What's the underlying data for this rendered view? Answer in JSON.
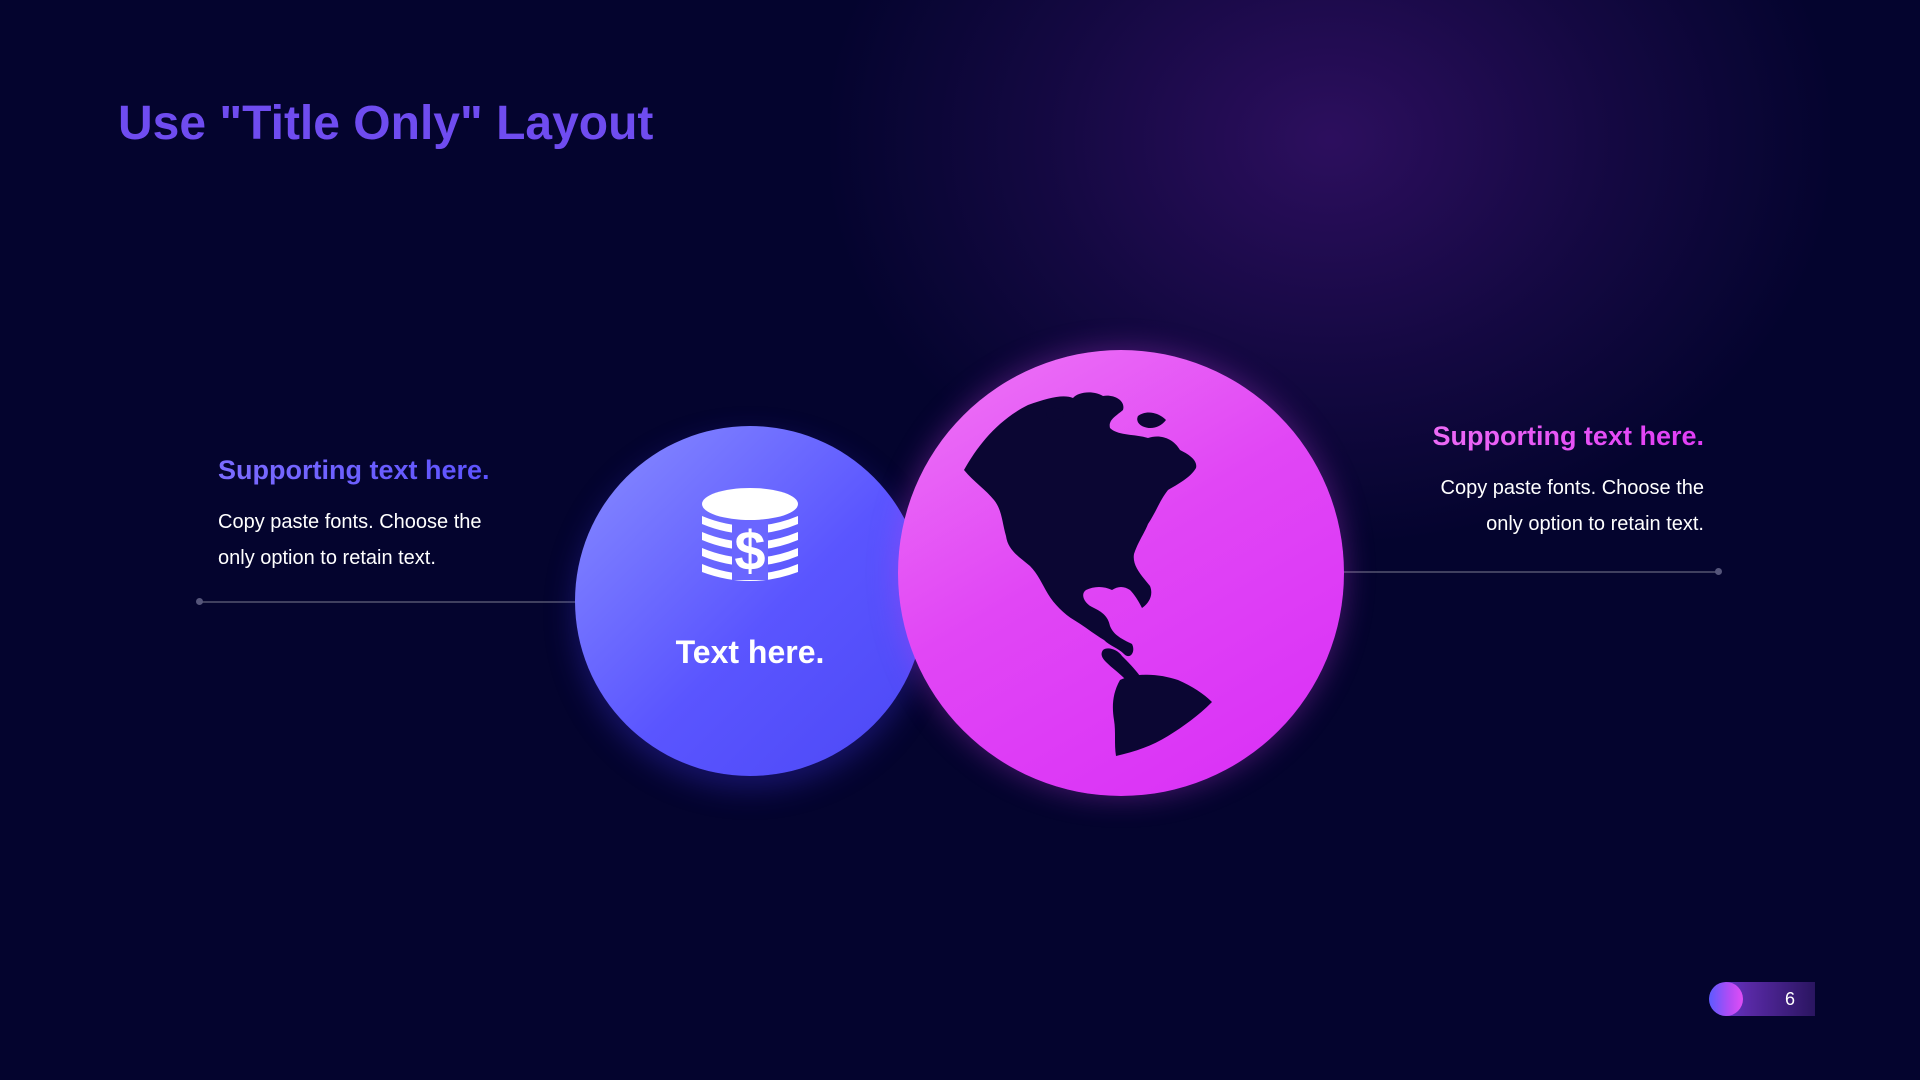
{
  "slide": {
    "title": "Use \"Title Only\" Layout",
    "page_number": "6"
  },
  "left_block": {
    "heading": "Supporting text here.",
    "body_line1": "Copy paste fonts. Choose the",
    "body_line2": "only option to retain text."
  },
  "right_block": {
    "heading": "Supporting text here.",
    "body_line1": "Copy paste fonts. Choose the",
    "body_line2": "only option to retain text."
  },
  "money_circle": {
    "label": "Text here.",
    "icon": "money-coins-icon"
  },
  "globe_circle": {
    "icon": "globe-americas-icon"
  },
  "colors": {
    "background": "#04042e",
    "title": "#6f4cf0",
    "blue_accent": "#5a55ff",
    "magenta_accent": "#e146f5",
    "text": "#ffffff"
  }
}
